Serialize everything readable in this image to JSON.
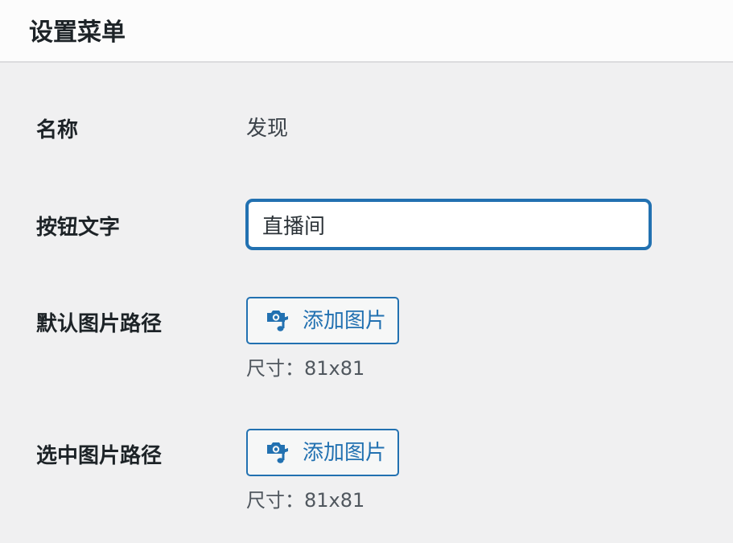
{
  "header": {
    "title": "设置菜单"
  },
  "form": {
    "name": {
      "label": "名称",
      "value": "发现"
    },
    "button_text": {
      "label": "按钮文字",
      "value": "直播间"
    },
    "default_image": {
      "label": "默认图片路径",
      "button_label": "添加图片",
      "button_icon": "add-media-icon",
      "size_hint": "尺寸：81x81"
    },
    "selected_image": {
      "label": "选中图片路径",
      "button_label": "添加图片",
      "button_icon": "add-media-icon",
      "size_hint": "尺寸：81x81"
    }
  },
  "colors": {
    "accent": "#2271b1",
    "background": "#f0f0f1",
    "header_bg": "#fcfcfc",
    "text": "#1d2327"
  }
}
